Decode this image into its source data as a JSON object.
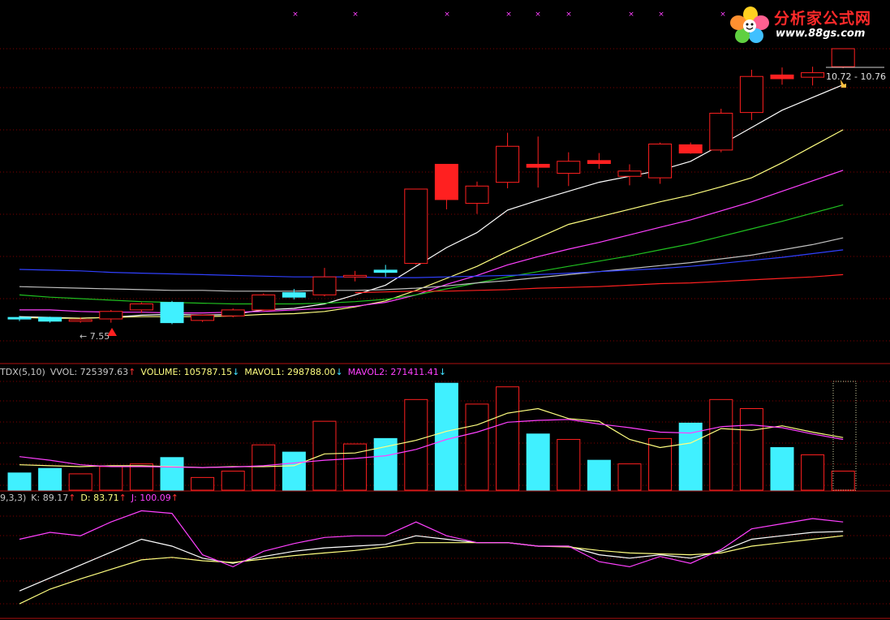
{
  "branding": {
    "title": "分析家公式网",
    "url": "www.88gs.com"
  },
  "colors": {
    "up": "#ff2020",
    "down": "#40f0ff",
    "ma5": "#ffffff",
    "ma10": "#ffff80",
    "ma20": "#ff40ff",
    "ma30": "#20c020",
    "ma60": "#c0c0c0",
    "ma120": "#3040ff",
    "ma250": "#ff2020",
    "grid": "#ff2020"
  },
  "main_panel": {
    "range_label": "10.72 - 10.76",
    "low_label": "← 7.55"
  },
  "volume_panel": {
    "readouts": [
      {
        "text": "TDX(5,10)",
        "arrow": "",
        "color": "#c8c8c8"
      },
      {
        "text": "VVOL: 725397.63",
        "arrow": "↑",
        "color": "#c8c8c8"
      },
      {
        "text": "VOLUME: 105787.15",
        "arrow": "↓",
        "color": "#ffff80"
      },
      {
        "text": "MAVOL1: 298788.00",
        "arrow": "↓",
        "color": "#ffff80"
      },
      {
        "text": "MAVOL2: 271411.41",
        "arrow": "↓",
        "color": "#ff40ff"
      }
    ]
  },
  "kdj_panel": {
    "readouts": [
      {
        "text": "9,3,3)",
        "arrow": "",
        "color": "#c8c8c8"
      },
      {
        "text": "K: 89.17",
        "arrow": "↑",
        "color": "#c8c8c8"
      },
      {
        "text": "D: 83.71",
        "arrow": "↑",
        "color": "#ffff80"
      },
      {
        "text": "J: 100.09",
        "arrow": "↑",
        "color": "#ff40ff"
      }
    ]
  },
  "chart_data": [
    {
      "type": "candlestick",
      "ylim": [
        7.2,
        11.2
      ],
      "candles": [
        {
          "o": 7.62,
          "h": 7.64,
          "l": 7.57,
          "c": 7.6,
          "dir": "down"
        },
        {
          "o": 7.62,
          "h": 7.63,
          "l": 7.55,
          "c": 7.57,
          "dir": "down"
        },
        {
          "o": 7.57,
          "h": 7.62,
          "l": 7.55,
          "c": 7.59,
          "dir": "up"
        },
        {
          "o": 7.6,
          "h": 7.72,
          "l": 7.55,
          "c": 7.7,
          "dir": "up"
        },
        {
          "o": 7.72,
          "h": 7.82,
          "l": 7.68,
          "c": 7.8,
          "dir": "up"
        },
        {
          "o": 7.82,
          "h": 7.84,
          "l": 7.53,
          "c": 7.55,
          "dir": "down"
        },
        {
          "o": 7.58,
          "h": 7.66,
          "l": 7.56,
          "c": 7.65,
          "dir": "up"
        },
        {
          "o": 7.64,
          "h": 7.74,
          "l": 7.62,
          "c": 7.72,
          "dir": "up"
        },
        {
          "o": 7.72,
          "h": 7.94,
          "l": 7.7,
          "c": 7.92,
          "dir": "up"
        },
        {
          "o": 7.95,
          "h": 8.0,
          "l": 7.86,
          "c": 7.89,
          "dir": "down"
        },
        {
          "o": 7.92,
          "h": 8.28,
          "l": 7.9,
          "c": 8.16,
          "dir": "up"
        },
        {
          "o": 8.16,
          "h": 8.24,
          "l": 8.1,
          "c": 8.18,
          "dir": "up"
        },
        {
          "o": 8.25,
          "h": 8.32,
          "l": 8.16,
          "c": 8.22,
          "dir": "down"
        },
        {
          "o": 8.34,
          "h": 9.33,
          "l": 8.32,
          "c": 9.33,
          "dir": "up"
        },
        {
          "o": 9.66,
          "h": 9.66,
          "l": 9.06,
          "c": 9.19,
          "dir": "down"
        },
        {
          "o": 9.14,
          "h": 9.43,
          "l": 9.0,
          "c": 9.37,
          "dir": "up"
        },
        {
          "o": 9.42,
          "h": 10.08,
          "l": 9.34,
          "c": 9.9,
          "dir": "up"
        },
        {
          "o": 9.66,
          "h": 10.03,
          "l": 9.35,
          "c": 9.62,
          "dir": "down"
        },
        {
          "o": 9.54,
          "h": 9.82,
          "l": 9.37,
          "c": 9.7,
          "dir": "up"
        },
        {
          "o": 9.71,
          "h": 9.81,
          "l": 9.6,
          "c": 9.67,
          "dir": "down"
        },
        {
          "o": 9.5,
          "h": 9.66,
          "l": 9.38,
          "c": 9.57,
          "dir": "up"
        },
        {
          "o": 9.48,
          "h": 9.95,
          "l": 9.4,
          "c": 9.93,
          "dir": "up"
        },
        {
          "o": 9.92,
          "h": 9.95,
          "l": 9.8,
          "c": 9.81,
          "dir": "down"
        },
        {
          "o": 9.85,
          "h": 10.4,
          "l": 9.82,
          "c": 10.34,
          "dir": "up"
        },
        {
          "o": 10.35,
          "h": 10.92,
          "l": 10.25,
          "c": 10.83,
          "dir": "up"
        },
        {
          "o": 10.85,
          "h": 10.95,
          "l": 10.72,
          "c": 10.8,
          "dir": "down"
        },
        {
          "o": 10.82,
          "h": 10.96,
          "l": 10.71,
          "c": 10.88,
          "dir": "up"
        },
        {
          "o": 10.96,
          "h": 11.2,
          "l": 10.94,
          "c": 11.2,
          "dir": "up"
        }
      ],
      "ma_series": [
        {
          "key": "ma5",
          "values": [
            7.63,
            7.62,
            7.61,
            7.62,
            7.65,
            7.66,
            7.65,
            7.66,
            7.72,
            7.74,
            7.8,
            7.92,
            8.05,
            8.3,
            8.55,
            8.75,
            9.05,
            9.18,
            9.3,
            9.42,
            9.5,
            9.58,
            9.7,
            9.92,
            10.15,
            10.38,
            10.55,
            10.72
          ]
        },
        {
          "key": "ma10",
          "values": [
            7.62,
            7.61,
            7.61,
            7.62,
            7.63,
            7.63,
            7.63,
            7.64,
            7.66,
            7.67,
            7.7,
            7.76,
            7.84,
            7.98,
            8.14,
            8.3,
            8.5,
            8.68,
            8.86,
            8.96,
            9.06,
            9.16,
            9.25,
            9.36,
            9.48,
            9.68,
            9.9,
            10.12
          ]
        },
        {
          "key": "ma20",
          "values": [
            7.72,
            7.72,
            7.7,
            7.69,
            7.69,
            7.68,
            7.68,
            7.69,
            7.7,
            7.72,
            7.74,
            7.77,
            7.82,
            7.92,
            8.06,
            8.18,
            8.32,
            8.43,
            8.53,
            8.62,
            8.72,
            8.82,
            8.92,
            9.04,
            9.16,
            9.3,
            9.44,
            9.58
          ]
        },
        {
          "key": "ma30",
          "values": [
            7.92,
            7.89,
            7.87,
            7.85,
            7.83,
            7.82,
            7.81,
            7.8,
            7.8,
            7.8,
            7.81,
            7.83,
            7.86,
            7.92,
            8.0,
            8.08,
            8.16,
            8.23,
            8.3,
            8.37,
            8.44,
            8.52,
            8.6,
            8.7,
            8.8,
            8.9,
            9.01,
            9.12
          ]
        },
        {
          "key": "ma60",
          "values": [
            8.03,
            8.02,
            8.01,
            8.0,
            7.99,
            7.98,
            7.98,
            7.97,
            7.97,
            7.97,
            7.98,
            7.98,
            7.99,
            8.01,
            8.04,
            8.08,
            8.11,
            8.15,
            8.19,
            8.23,
            8.27,
            8.31,
            8.35,
            8.4,
            8.45,
            8.52,
            8.59,
            8.68
          ]
        },
        {
          "key": "ma120",
          "values": [
            8.26,
            8.25,
            8.24,
            8.22,
            8.21,
            8.2,
            8.19,
            8.18,
            8.17,
            8.16,
            8.16,
            8.16,
            8.15,
            8.15,
            8.16,
            8.17,
            8.18,
            8.19,
            8.21,
            8.23,
            8.25,
            8.27,
            8.3,
            8.34,
            8.38,
            8.42,
            8.47,
            8.52
          ]
        },
        {
          "key": "ma250",
          "values": [
            null,
            null,
            null,
            null,
            null,
            null,
            null,
            null,
            null,
            null,
            null,
            7.95,
            7.96,
            7.97,
            7.97,
            7.98,
            7.99,
            8.01,
            8.02,
            8.03,
            8.05,
            8.07,
            8.08,
            8.1,
            8.12,
            8.14,
            8.16,
            8.19
          ]
        }
      ]
    },
    {
      "type": "bar",
      "ylim": [
        0,
        1200
      ],
      "series": [
        {
          "name": "VOLUME",
          "values": [
            190,
            240,
            180,
            260,
            290,
            360,
            140,
            210,
            500,
            420,
            760,
            510,
            570,
            1000,
            1180,
            950,
            1140,
            620,
            560,
            330,
            290,
            570,
            740,
            1000,
            900,
            470,
            390,
            210
          ]
        },
        {
          "name": "MAVOL1",
          "values": [
            280,
            270,
            260,
            270,
            270,
            260,
            250,
            260,
            260,
            270,
            400,
            410,
            480,
            550,
            650,
            720,
            850,
            900,
            790,
            760,
            560,
            470,
            520,
            680,
            660,
            710,
            640,
            580
          ]
        },
        {
          "name": "MAVOL2",
          "values": [
            370,
            330,
            280,
            260,
            260,
            255,
            250,
            255,
            270,
            300,
            330,
            350,
            380,
            450,
            560,
            640,
            750,
            770,
            780,
            730,
            690,
            640,
            630,
            700,
            720,
            690,
            620,
            560
          ]
        }
      ]
    },
    {
      "type": "line",
      "ylim": [
        -10,
        120
      ],
      "series": [
        {
          "name": "K",
          "values": [
            20,
            35,
            50,
            65,
            80,
            72,
            58,
            52,
            60,
            66,
            70,
            72,
            74,
            84,
            80,
            76,
            76,
            72,
            72,
            62,
            58,
            62,
            58,
            66,
            80,
            84,
            88,
            89
          ]
        },
        {
          "name": "D",
          "values": [
            5,
            22,
            34,
            45,
            56,
            59,
            55,
            53,
            57,
            61,
            64,
            67,
            71,
            76,
            76,
            76,
            76,
            72,
            71,
            67,
            64,
            63,
            62,
            64,
            72,
            76,
            80,
            84
          ]
        },
        {
          "name": "J",
          "values": [
            80,
            88,
            84,
            100,
            113,
            110,
            62,
            48,
            66,
            75,
            82,
            84,
            84,
            100,
            84,
            76,
            76,
            72,
            72,
            54,
            48,
            60,
            52,
            68,
            92,
            98,
            104,
            100
          ]
        }
      ]
    }
  ]
}
